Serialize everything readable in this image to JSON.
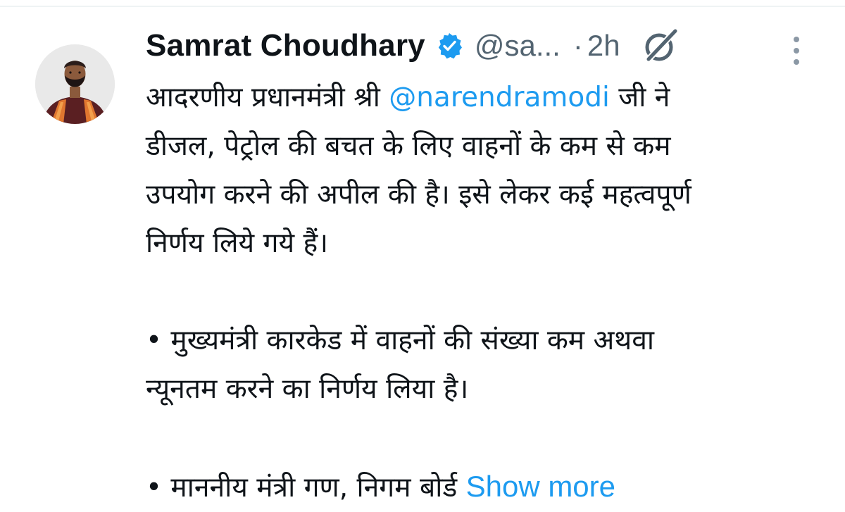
{
  "author": {
    "name": "Samrat Choudhary",
    "handle": "@sa...",
    "separator": "·",
    "time": "2h",
    "verified_icon": "verified-badge-icon",
    "verified_color": "#1d9bf0"
  },
  "actions": {
    "grok_icon": "grok-icon",
    "more_icon": "more-options-icon"
  },
  "tweet": {
    "line1_before": "आदरणीय प्रधानमंत्री श्री ",
    "mention": "@narendramodi",
    "line1_after": " जी ने",
    "line2": "डीजल, पेट्रोल की बचत के लिए वाहनों के कम से कम",
    "line3": "उपयोग करने की अपील की है। इसे लेकर कई महत्वपूर्ण",
    "line4": "निर्णय लिये गये हैं।",
    "bullet1_line1": "• मुख्यमंत्री कारकेड में वाहनों की संख्या कम अथवा",
    "bullet1_line2": "न्यूनतम करने का निर्णय लिया है।",
    "bullet2_line1": "• माननीय मंत्री गण, निगम बोर्ड ",
    "show_more": "Show more"
  },
  "colors": {
    "link": "#1d9bf0",
    "text": "#0f1419",
    "muted": "#536471"
  }
}
